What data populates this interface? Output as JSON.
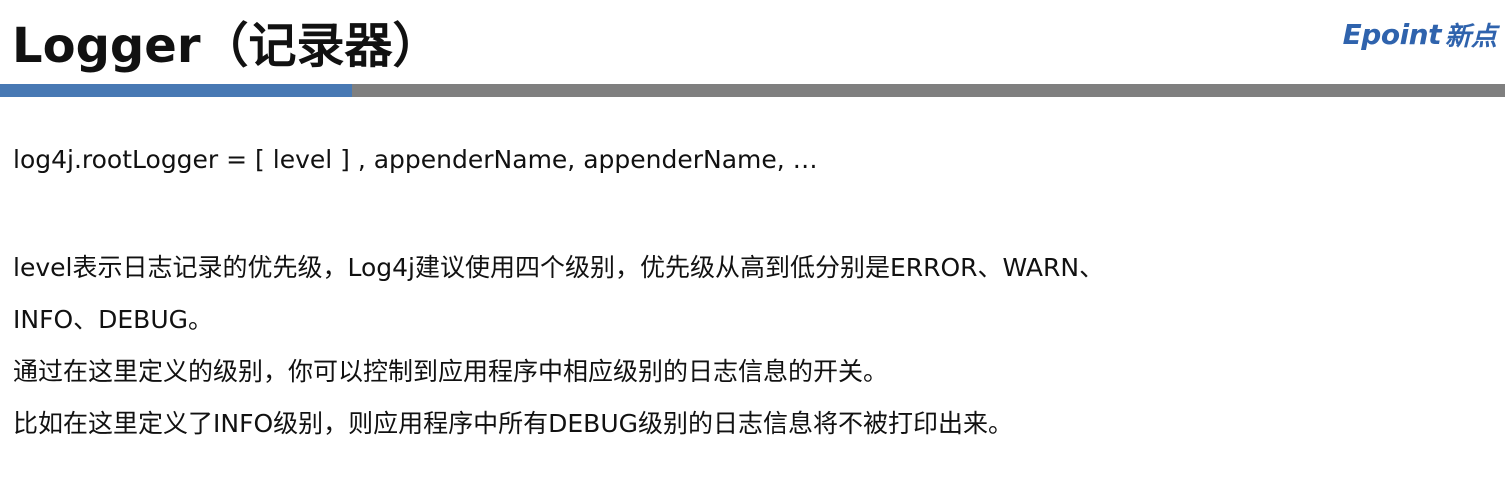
{
  "header": {
    "title": "Logger（记录器）",
    "brand": {
      "name_en": "Epoint",
      "name_cn": "新点",
      "color": "#2f63ad"
    },
    "rule_colors": {
      "accent": "#4879b4",
      "rest": "#7f7f7f"
    }
  },
  "content": {
    "syntax": "log4j.rootLogger = [ level ] , appenderName, appenderName, …",
    "paragraphs": [
      "level表示日志记录的优先级，Log4j建议使用四个级别，优先级从高到低分别是ERROR、WARN、",
      "INFO、DEBUG。",
      "通过在这里定义的级别，你可以控制到应用程序中相应级别的日志信息的开关。",
      "比如在这里定义了INFO级别，则应用程序中所有DEBUG级别的日志信息将不被打印出来。"
    ]
  }
}
